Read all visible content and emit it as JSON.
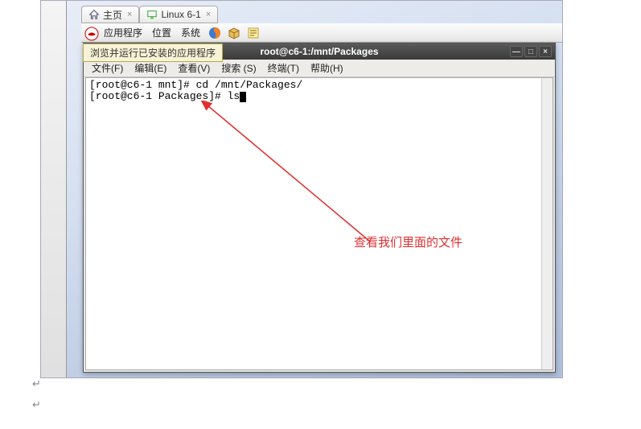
{
  "tabs": {
    "home": {
      "label": "主页"
    },
    "linux": {
      "label": "Linux 6-1"
    }
  },
  "gnome_panel": {
    "applications": "应用程序",
    "places": "位置",
    "system": "系统"
  },
  "tooltip": "浏览并运行已安装的应用程序",
  "terminal": {
    "title": "root@c6-1:/mnt/Packages",
    "menubar": {
      "file": "文件(F)",
      "edit": "编辑(E)",
      "view": "查看(V)",
      "search": "搜索 (S)",
      "terminal": "终端(T)",
      "help": "帮助(H)"
    },
    "lines": [
      "[root@c6-1 mnt]# cd /mnt/Packages/",
      "[root@c6-1 Packages]# ls"
    ]
  },
  "annotation": "查看我们里面的文件",
  "window_controls": {
    "minimize": "—",
    "maximize": "□",
    "close": "×"
  },
  "tab_close": "×"
}
